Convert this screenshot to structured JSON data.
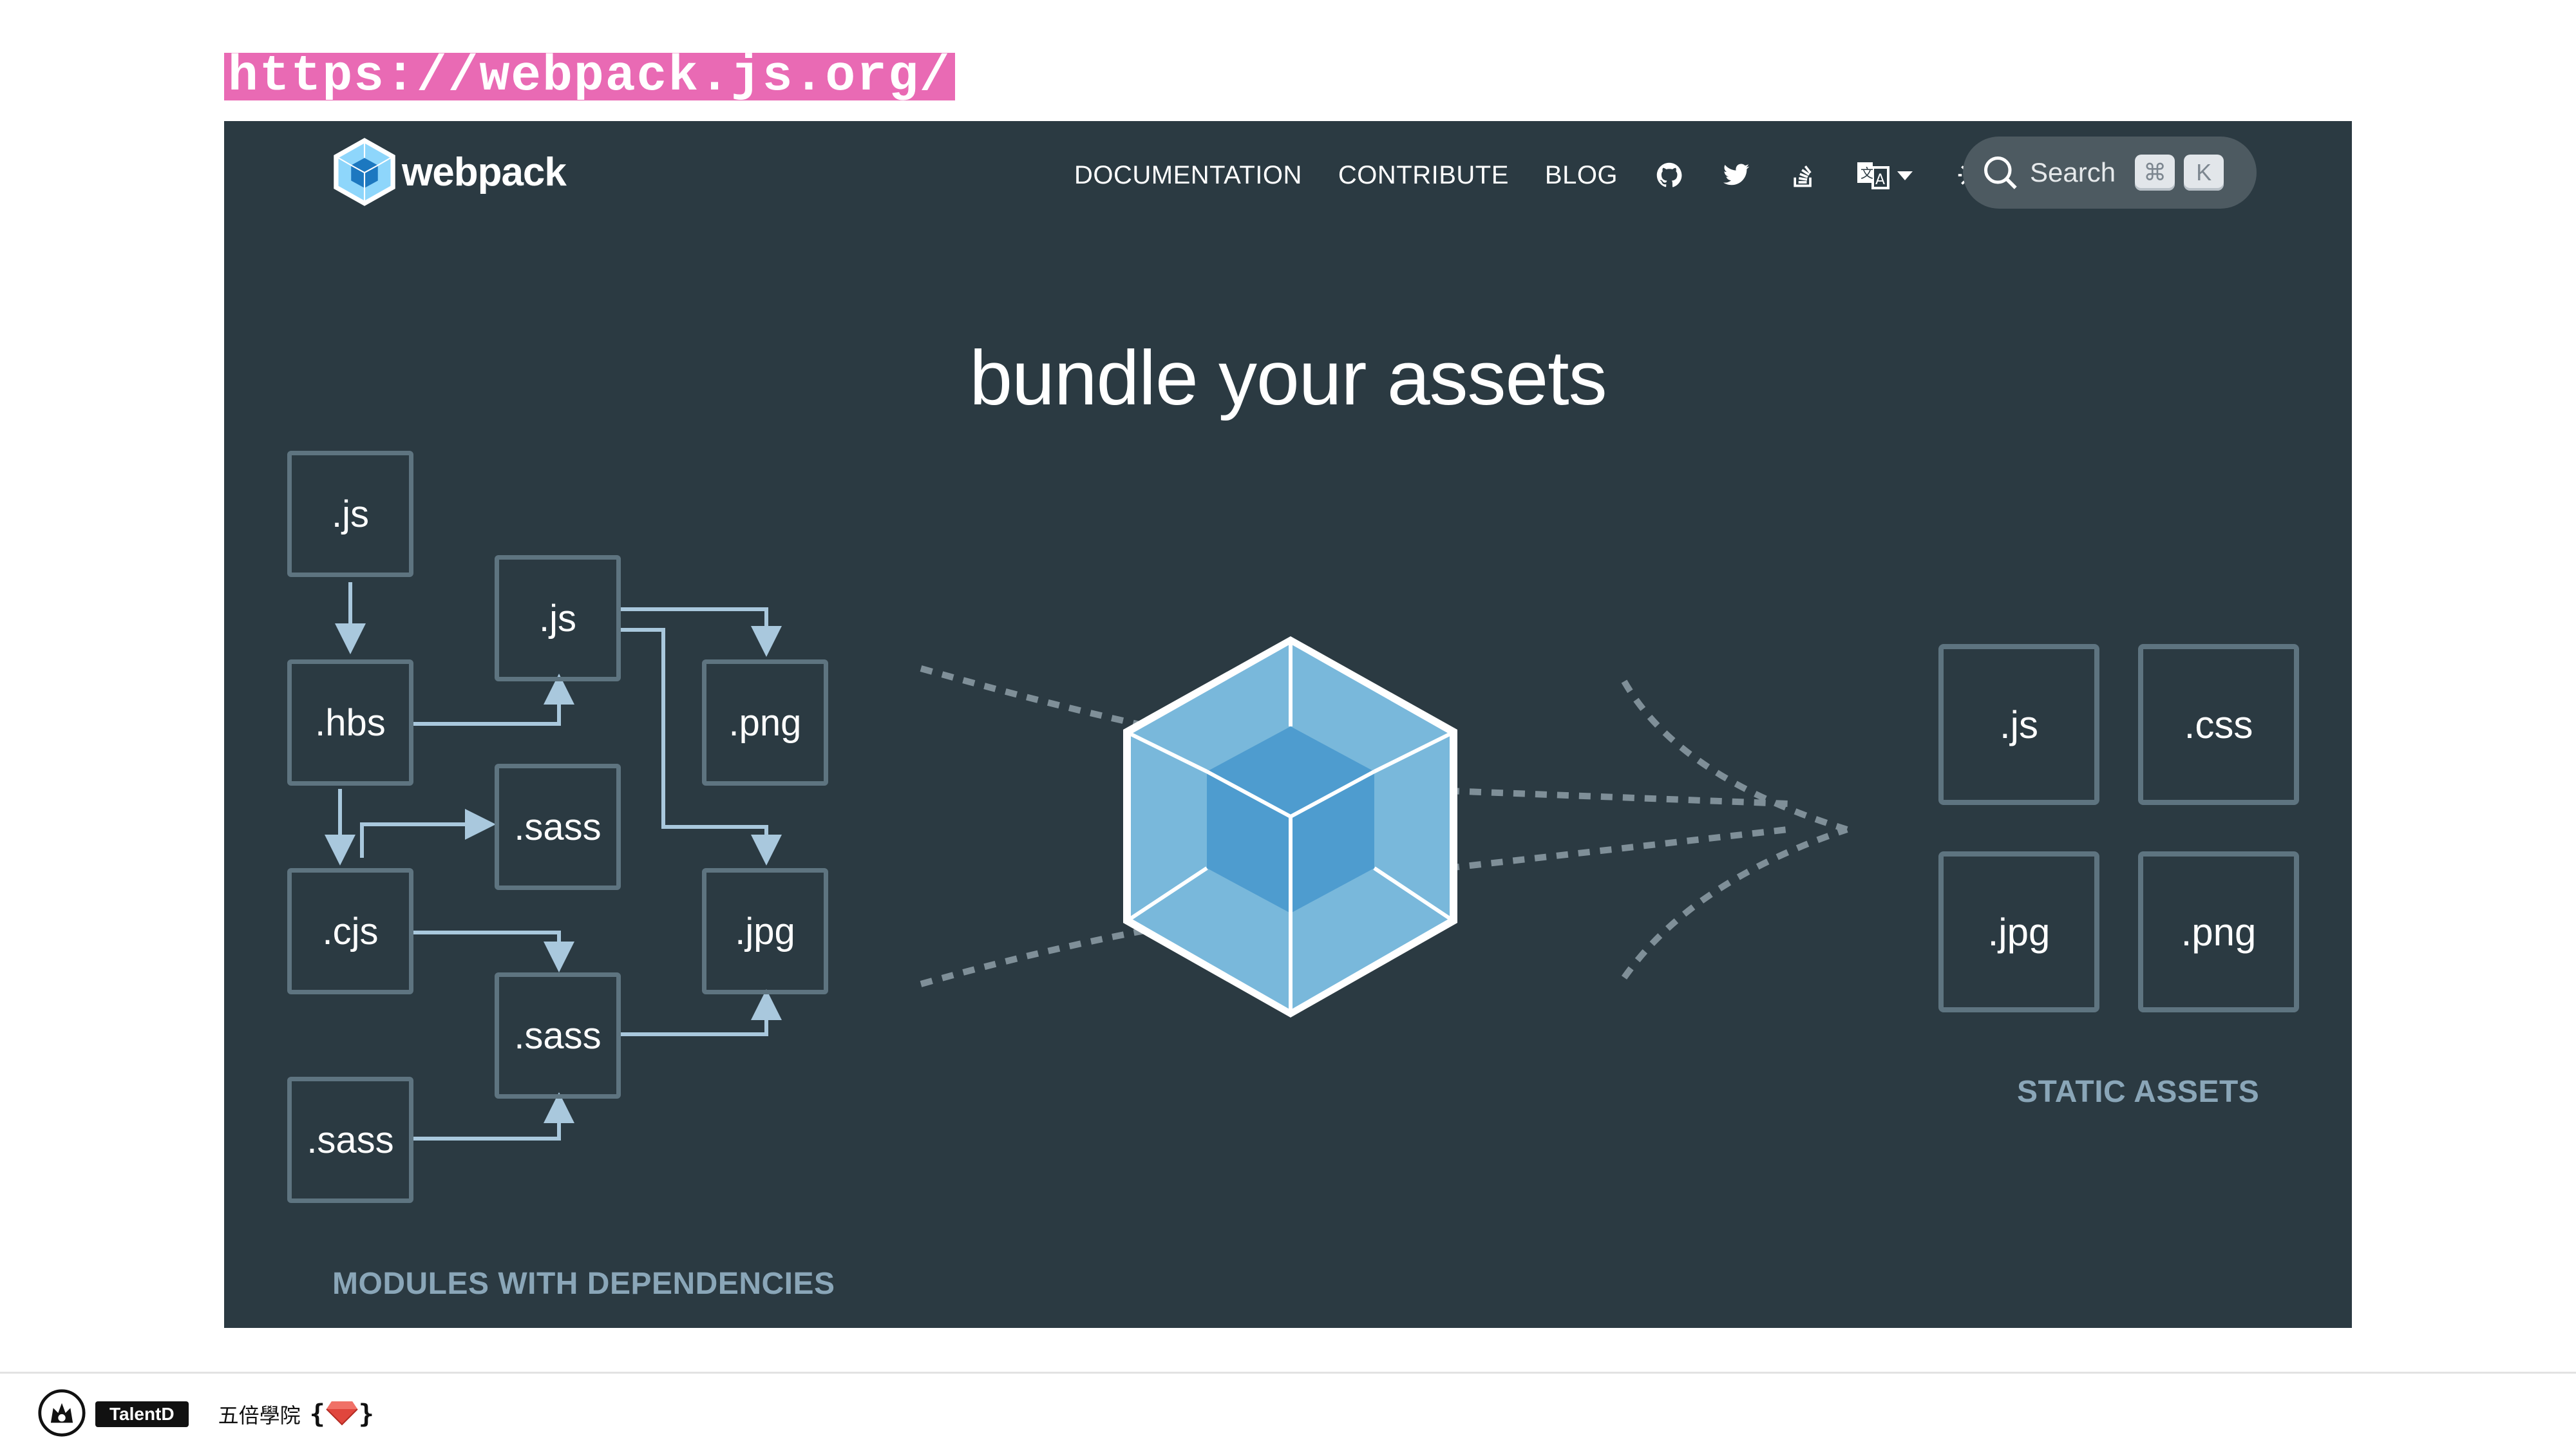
{
  "banner": {
    "url": "https://webpack.js.org/"
  },
  "header": {
    "logo_text": "webpack",
    "nav": [
      "DOCUMENTATION",
      "CONTRIBUTE",
      "BLOG"
    ],
    "icons": [
      "github-icon",
      "twitter-icon",
      "stack-overflow-icon",
      "language-icon",
      "theme-sun-icon"
    ],
    "search": {
      "label": "Search",
      "shortcut_cmd": "⌘",
      "shortcut_key": "K"
    }
  },
  "hero": {
    "title": "bundle your assets"
  },
  "modules": {
    "caption": "MODULES WITH DEPENDENCIES",
    "items": [
      ".js",
      ".js",
      ".hbs",
      ".png",
      ".sass",
      ".cjs",
      ".jpg",
      ".sass",
      ".sass"
    ]
  },
  "outputs": {
    "caption": "STATIC ASSETS",
    "items": [
      ".js",
      ".css",
      ".jpg",
      ".png"
    ]
  },
  "footer": {
    "brand": "TalentD",
    "school": "五倍學院",
    "brace_open": "{",
    "brace_close": "}"
  },
  "colors": {
    "background": "#2b3a42",
    "box_border": "#5e7480",
    "arrow": "#a9c8dd",
    "cube_light": "#8ed6fb",
    "cube_dark": "#1c78c0",
    "banner": "#e96ab4"
  }
}
